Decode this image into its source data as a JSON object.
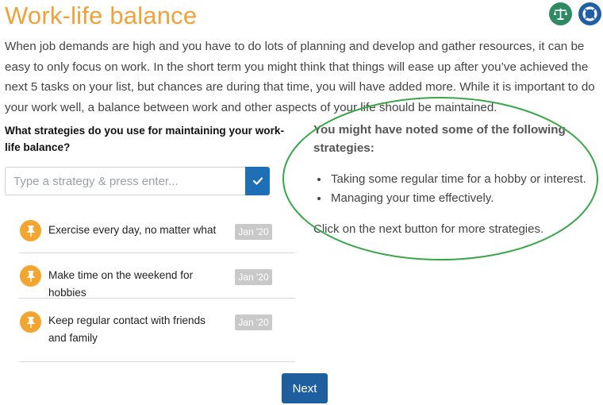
{
  "page": {
    "title": "Work-life balance",
    "intro": "When job demands are high and you have to do lots of planning and develop and gather resources, it can be easy to only focus on work. In the short term you might think that things will ease up after you’ve achieved the next 5 tasks on your list, but chances are during that time, you will have added more.  While it is important to do your work well, a balance between work and other aspects of your life should be maintained."
  },
  "header_icons": [
    {
      "name": "scales-icon",
      "color": "#2f8a64"
    },
    {
      "name": "lifebuoy-icon",
      "color": "#1f5fa6"
    }
  ],
  "question": "What strategies do you use for maintaining your work-life balance?",
  "input": {
    "value": "",
    "placeholder": "Type a strategy & press enter...",
    "submit_icon": "checkmark-icon"
  },
  "strategies": [
    {
      "text": "Exercise every day, no matter what",
      "date": "Jan '20",
      "icon": "pushpin-icon"
    },
    {
      "text": "Make time on the weekend for hobbies",
      "date": "Jan '20",
      "icon": "pushpin-icon"
    },
    {
      "text": "Keep regular contact with friends and family",
      "date": "Jan '20",
      "icon": "pushpin-icon"
    }
  ],
  "callout": {
    "heading": "You might have noted some of the following strategies:",
    "items": [
      "Taking some regular time for a hobby or interest.",
      "Managing your time effectively."
    ],
    "note": "Click on the next button for more strategies."
  },
  "next_label": "Next",
  "colors": {
    "title": "#f0a23a",
    "primary": "#1f6fb6",
    "pin": "#f3a530",
    "highlight": "#3aa64a"
  }
}
